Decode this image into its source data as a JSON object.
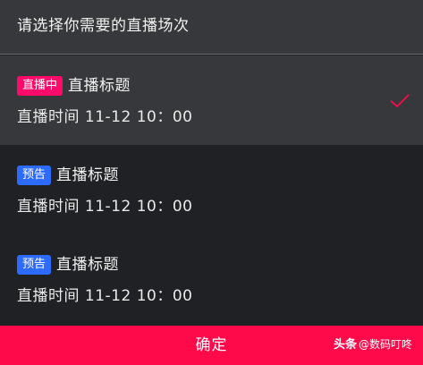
{
  "header": {
    "title": "请选择你需要的直播场次"
  },
  "sessions": [
    {
      "badge": "直播中",
      "badge_color": "#fe0a6a",
      "title": "直播标题",
      "time": "直播时间 11-12 10：00",
      "selected": true
    },
    {
      "badge": "预告",
      "badge_color": "#2d6bff",
      "title": "直播标题",
      "time": "直播时间 11-12 10：00",
      "selected": false
    },
    {
      "badge": "预告",
      "badge_color": "#2d6bff",
      "title": "直播标题",
      "time": "直播时间 11-12 10：00",
      "selected": false
    }
  ],
  "check_icon": "checkmark-icon",
  "check_color": "#fe0a4b",
  "confirm": {
    "label": "确定",
    "color": "#fe0a4b"
  },
  "watermark": {
    "brand": "头条",
    "handle": "@数码叮咚"
  }
}
